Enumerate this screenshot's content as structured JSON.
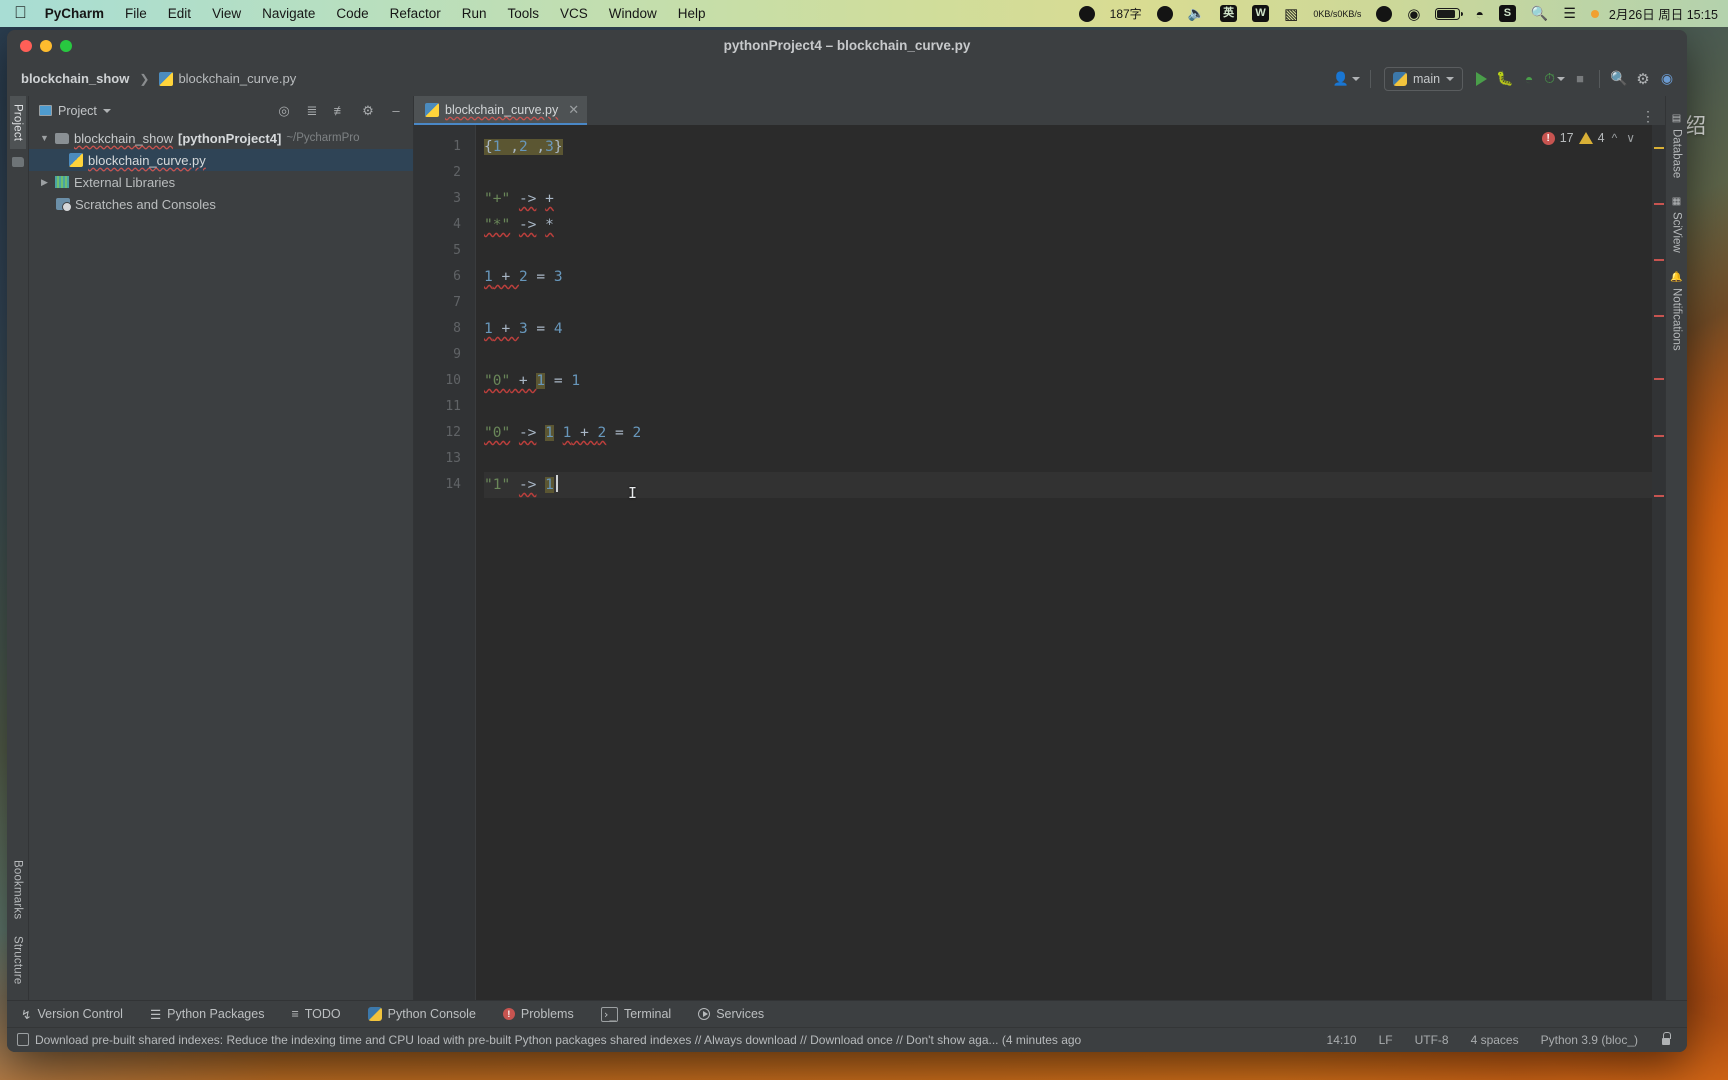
{
  "menubar": {
    "apple_icon": "apple-logo",
    "items": [
      "PyCharm",
      "File",
      "Edit",
      "View",
      "Navigate",
      "Code",
      "Refactor",
      "Run",
      "Tools",
      "VCS",
      "Window",
      "Help"
    ],
    "status_items": [
      {
        "name": "record-icon",
        "glyph": "●"
      },
      {
        "name": "input-count",
        "text": "187字"
      },
      {
        "name": "smiley-icon",
        "glyph": "☺"
      },
      {
        "name": "microphone-icon",
        "glyph": "🎙"
      },
      {
        "name": "input-method-icon",
        "text": "英"
      },
      {
        "name": "wechat-work-icon",
        "text": "W"
      },
      {
        "name": "bag-icon",
        "glyph": "▮"
      },
      {
        "name": "network-speed",
        "up": "0KB/s",
        "down": "0KB/s"
      },
      {
        "name": "vpn-icon",
        "glyph": "◀"
      },
      {
        "name": "media-play-icon",
        "glyph": "▶"
      },
      {
        "name": "battery-icon",
        "glyph": ""
      },
      {
        "name": "wifi-icon",
        "glyph": "▾"
      },
      {
        "name": "sogou-icon",
        "text": "S"
      },
      {
        "name": "spotlight-search-icon",
        "glyph": "⚲"
      },
      {
        "name": "control-center-icon",
        "glyph": "⌸"
      },
      {
        "name": "siri-dot-icon",
        "glyph": ""
      }
    ],
    "clock": "2月26日 周日 15:15"
  },
  "window": {
    "title": "pythonProject4 – blockchain_curve.py"
  },
  "navbar": {
    "breadcrumb": [
      "blockchain_show",
      "blockchain_curve.py"
    ],
    "run_config": "main",
    "buttons": [
      "run-button",
      "debug-button",
      "run-coverage-button",
      "profile-button",
      "stop-button",
      "search-everywhere-button",
      "settings-button",
      "account-button"
    ]
  },
  "project_panel": {
    "title": "Project",
    "toolbar_icons": [
      "locate-icon",
      "expand-all-icon",
      "collapse-all-icon",
      "settings-gear-icon",
      "hide-icon"
    ],
    "tree": [
      {
        "label": "blockchain_show",
        "bold_suffix": "[pythonProject4]",
        "path": "~/PycharmPro",
        "level": 0,
        "kind": "folder",
        "expanded": true,
        "selected": false
      },
      {
        "label": "blockchain_curve.py",
        "level": 1,
        "kind": "python-file",
        "selected": true
      },
      {
        "label": "External Libraries",
        "level": 0,
        "kind": "library",
        "expanded": false,
        "selected": false
      },
      {
        "label": "Scratches and Consoles",
        "level": 0,
        "kind": "scratch",
        "selected": false
      }
    ]
  },
  "left_strip": {
    "tabs": [
      "Project",
      "Bookmarks",
      "Structure"
    ],
    "selected": "Project"
  },
  "right_strip": {
    "tabs": [
      "Database",
      "SciView",
      "Notifications"
    ]
  },
  "editor": {
    "tab_label": "blockchain_curve.py",
    "inspection": {
      "errors": "17",
      "warnings": "4"
    },
    "lines": [
      {
        "n": "1",
        "segments": [
          {
            "t": "{",
            "c": "plain",
            "hl": true
          },
          {
            "t": "1",
            "c": "num",
            "hl": true
          },
          {
            "t": " ,",
            "c": "plain",
            "hl": true
          },
          {
            "t": "2",
            "c": "num",
            "hl": true
          },
          {
            "t": " ,",
            "c": "plain",
            "hl": true
          },
          {
            "t": "3",
            "c": "num",
            "hl": true
          },
          {
            "t": "}",
            "c": "plain",
            "hl": true
          }
        ]
      },
      {
        "n": "2",
        "segments": []
      },
      {
        "n": "3",
        "segments": [
          {
            "t": "\"+\"",
            "c": "str"
          },
          {
            "t": " ",
            "c": "plain"
          },
          {
            "t": "->",
            "c": "plain",
            "wav": true
          },
          {
            "t": " ",
            "c": "plain"
          },
          {
            "t": "+",
            "c": "plain",
            "wav": true
          }
        ]
      },
      {
        "n": "4",
        "segments": [
          {
            "t": "\"*\"",
            "c": "str",
            "wav": true
          },
          {
            "t": " ",
            "c": "plain"
          },
          {
            "t": "->",
            "c": "plain",
            "wav": true
          },
          {
            "t": " ",
            "c": "plain"
          },
          {
            "t": "*",
            "c": "plain",
            "wav": true
          }
        ]
      },
      {
        "n": "5",
        "segments": []
      },
      {
        "n": "6",
        "segments": [
          {
            "t": "1",
            "c": "num",
            "wav": true
          },
          {
            "t": " + ",
            "c": "plain",
            "wav": true
          },
          {
            "t": "2",
            "c": "num"
          },
          {
            "t": " = ",
            "c": "plain"
          },
          {
            "t": "3",
            "c": "num"
          }
        ]
      },
      {
        "n": "7",
        "segments": []
      },
      {
        "n": "8",
        "segments": [
          {
            "t": "1",
            "c": "num",
            "wav": true
          },
          {
            "t": " + ",
            "c": "plain",
            "wav": true
          },
          {
            "t": "3",
            "c": "num"
          },
          {
            "t": " = ",
            "c": "plain"
          },
          {
            "t": "4",
            "c": "num"
          }
        ]
      },
      {
        "n": "9",
        "segments": []
      },
      {
        "n": "10",
        "segments": [
          {
            "t": "\"0\"",
            "c": "str",
            "wav": true
          },
          {
            "t": " + ",
            "c": "plain",
            "wav": true
          },
          {
            "t": "1",
            "c": "num",
            "hl": true
          },
          {
            "t": " = ",
            "c": "plain"
          },
          {
            "t": "1",
            "c": "num"
          }
        ]
      },
      {
        "n": "11",
        "segments": []
      },
      {
        "n": "12",
        "segments": [
          {
            "t": "\"0\"",
            "c": "str",
            "wav": true
          },
          {
            "t": " ",
            "c": "plain"
          },
          {
            "t": "->",
            "c": "plain",
            "wav": true
          },
          {
            "t": " ",
            "c": "plain"
          },
          {
            "t": "1",
            "c": "num",
            "hl": true
          },
          {
            "t": " ",
            "c": "plain"
          },
          {
            "t": "1",
            "c": "num",
            "wav": true
          },
          {
            "t": " + ",
            "c": "plain",
            "wav": true
          },
          {
            "t": "2",
            "c": "num",
            "wav": true
          },
          {
            "t": " = ",
            "c": "plain"
          },
          {
            "t": "2",
            "c": "num"
          }
        ]
      },
      {
        "n": "13",
        "segments": []
      },
      {
        "n": "14",
        "segments": [
          {
            "t": "\"1\"",
            "c": "str"
          },
          {
            "t": " ",
            "c": "plain"
          },
          {
            "t": "->",
            "c": "plain",
            "wav": true
          },
          {
            "t": " ",
            "c": "plain"
          },
          {
            "t": "1",
            "c": "num",
            "hl": true
          }
        ],
        "current": true,
        "caret": true
      }
    ]
  },
  "bottom_bar": {
    "tabs": [
      "Version Control",
      "Python Packages",
      "TODO",
      "Python Console",
      "Problems",
      "Terminal",
      "Services"
    ]
  },
  "status_bar": {
    "message": "Download pre-built shared indexes: Reduce the indexing time and CPU load with pre-built Python packages shared indexes // Always download // Download once // Don't show aga... (4 minutes ago",
    "time": "14:10",
    "line_separator": "LF",
    "encoding": "UTF-8",
    "indent": "4 spaces",
    "interpreter": "Python 3.9 (bloc_)"
  },
  "desktop": {
    "widget_text": "介绍"
  },
  "colors": {
    "accent_blue": "#4a88c7",
    "error_red": "#c75450",
    "warning_yellow": "#d9b036",
    "string_green": "#6a8759",
    "number_blue": "#6897bb",
    "ide_bg": "#3c3f41",
    "editor_bg": "#2b2b2b"
  }
}
